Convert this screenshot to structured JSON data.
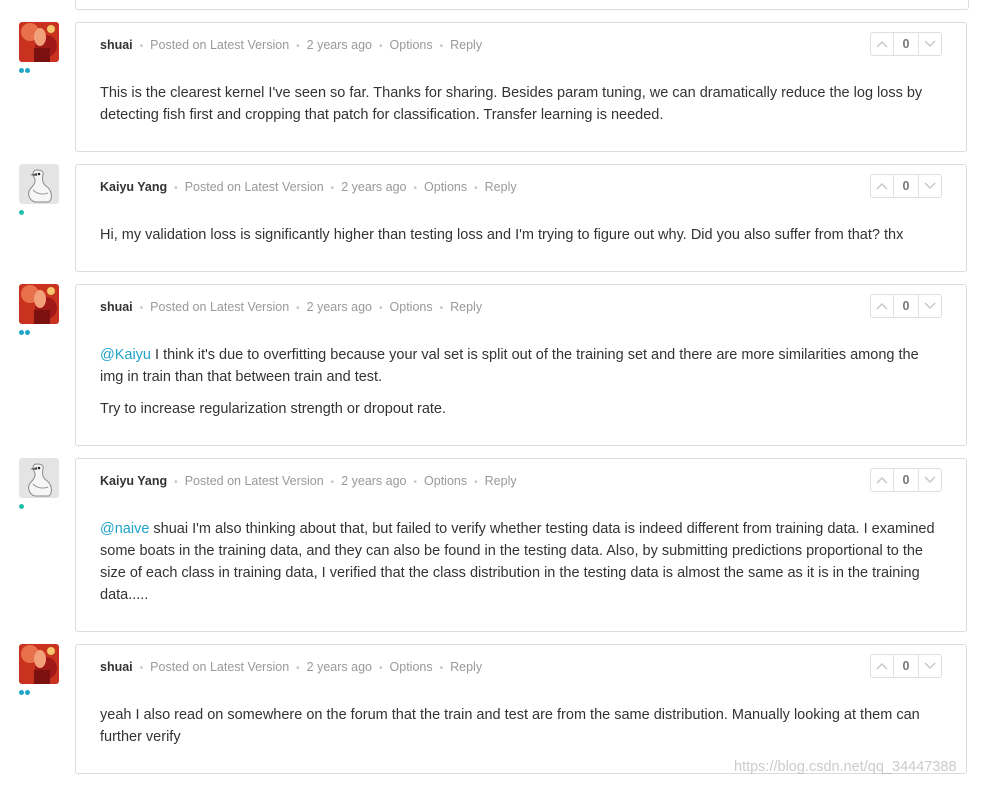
{
  "colors": {
    "accent": "#20a4c8",
    "tier_blue": "#20a4c8",
    "tier_green": "#20beaa",
    "border": "#dcdcdc",
    "muted": "#999999"
  },
  "comments": [
    {
      "author": "shuai",
      "posted": "Posted on Latest Version",
      "time": "2 years ago",
      "options": "Options",
      "reply": "Reply",
      "votes": "0",
      "avatar": "photo-avatar",
      "paragraphs": [
        {
          "text": "This is the clearest kernel I've seen so far. Thanks for sharing. Besides param tuning, we can dramatically reduce the log loss by detecting fish first and cropping that patch for classification. Transfer learning is needed."
        }
      ]
    },
    {
      "author": "Kaiyu Yang",
      "posted": "Posted on Latest Version",
      "time": "2 years ago",
      "options": "Options",
      "reply": "Reply",
      "votes": "0",
      "avatar": "goose-avatar",
      "paragraphs": [
        {
          "text": "Hi, my validation loss is significantly higher than testing loss and I'm trying to figure out why. Did you also suffer from that? thx"
        }
      ]
    },
    {
      "author": "shuai",
      "posted": "Posted on Latest Version",
      "time": "2 years ago",
      "options": "Options",
      "reply": "Reply",
      "votes": "0",
      "avatar": "photo-avatar",
      "paragraphs": [
        {
          "mention": "@Kaiyu",
          "text": " I think it's due to overfitting because your val set is split out of the training set and there are more similarities among the img in train than that between train and test."
        },
        {
          "text": "Try to increase regularization strength or dropout rate."
        }
      ]
    },
    {
      "author": "Kaiyu Yang",
      "posted": "Posted on Latest Version",
      "time": "2 years ago",
      "options": "Options",
      "reply": "Reply",
      "votes": "0",
      "avatar": "goose-avatar",
      "paragraphs": [
        {
          "mention": "@naive",
          "text": " shuai I'm also thinking about that, but failed to verify whether testing data is indeed different from training data. I examined some boats in the training data, and they can also be found in the testing data. Also, by submitting predictions proportional to the size of each class in training data, I verified that the class distribution in the testing data is almost the same as it is in the training data....."
        }
      ]
    },
    {
      "author": "shuai",
      "posted": "Posted on Latest Version",
      "time": "2 years ago",
      "options": "Options",
      "reply": "Reply",
      "votes": "0",
      "avatar": "photo-avatar",
      "paragraphs": [
        {
          "text": "yeah I also read on somewhere on the forum that the train and test are from the same distribution. Manually looking at them can further verify"
        }
      ]
    }
  ],
  "watermark": "https://blog.csdn.net/qq_34447388"
}
